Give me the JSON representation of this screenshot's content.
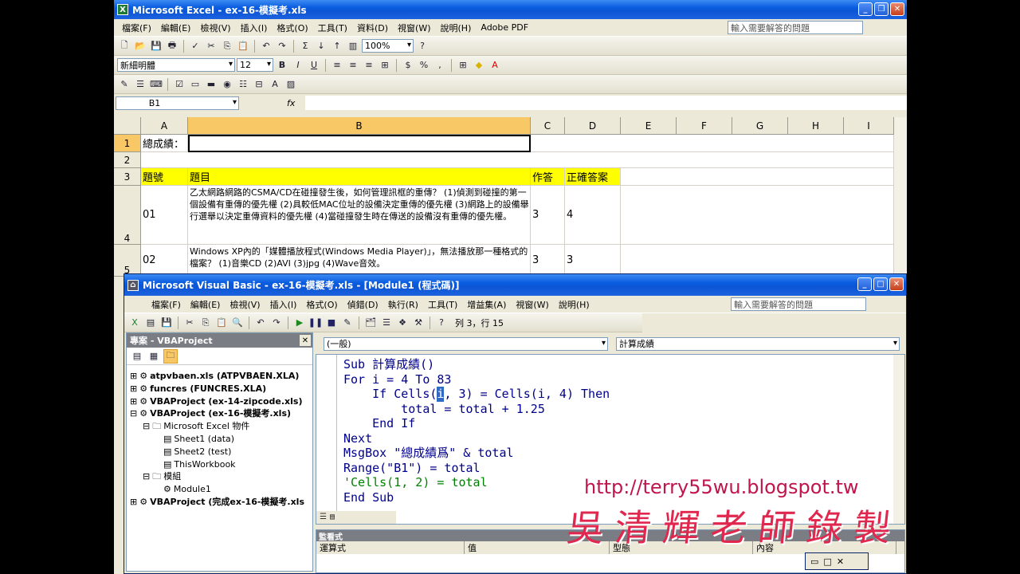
{
  "excel": {
    "title": "Microsoft Excel - ex-16-模擬考.xls",
    "menu": [
      "檔案(F)",
      "編輯(E)",
      "檢視(V)",
      "插入(I)",
      "格式(O)",
      "工具(T)",
      "資料(D)",
      "視窗(W)",
      "說明(H)",
      "Adobe PDF"
    ],
    "help_placeholder": "輸入需要解答的問題",
    "zoom": "100%",
    "font": "新細明體",
    "font_size": "12",
    "name_box": "B1",
    "fx": "fx",
    "columns": [
      "A",
      "B",
      "C",
      "D",
      "E",
      "F",
      "G",
      "H",
      "I"
    ],
    "rows": [
      "1",
      "2",
      "3",
      "4",
      "5"
    ],
    "cells": {
      "a1": "總成績：",
      "a3": "題號",
      "b3": "題目",
      "c3": "作答",
      "d3": "正確答案",
      "a4": "01",
      "b4": "乙太網路網路的CSMA/CD在碰撞發生後，如何管理訊框的重傳？ (1)偵測到碰撞的第一個設備有重傳的優先權 (2)具較低MAC位址的設備決定重傳的優先權 (3)網路上的設備舉行選舉以決定重傳資料的優先權 (4)當碰撞發生時在傳送的設備沒有重傳的優先權。",
      "c4": "3",
      "d4": "4",
      "a5": "02",
      "b5": "Windows XP內的「媒體播放程式(Windows Media Player)」，無法播放那一種格式的檔案？ (1)音樂CD (2)AVI (3)jpg (4)Wave音效。",
      "c5": "3",
      "d5": "3"
    }
  },
  "vbe": {
    "title": "Microsoft Visual Basic - ex-16-模擬考.xls - [Module1 (程式碼)]",
    "menu": [
      "檔案(F)",
      "編輯(E)",
      "檢視(V)",
      "插入(I)",
      "格式(O)",
      "偵錯(D)",
      "執行(R)",
      "工具(T)",
      "增益集(A)",
      "視窗(W)",
      "說明(H)"
    ],
    "help_placeholder": "輸入需要解答的問題",
    "position": "列 3，行 15",
    "project_title": "專案 - VBAProject",
    "tree": [
      "atpvbaen.xls (ATPVBAEN.XLA)",
      "funcres (FUNCRES.XLA)",
      "VBAProject (ex-14-zipcode.xls)",
      "VBAProject (ex-16-模擬考.xls)",
      "Microsoft Excel 物件",
      "Sheet1 (data)",
      "Sheet2 (test)",
      "ThisWorkbook",
      "模組",
      "Module1",
      "VBAProject (完成ex-16-模擬考.xls"
    ],
    "object_dropdown": "(一般)",
    "proc_dropdown": "計算成績",
    "code": {
      "l1": "Sub 計算成績()",
      "l2": "For i = 4 To 83",
      "l3a": "    If Cells(",
      "l3c": "i",
      "l3b": ", 3) = Cells(i, 4) Then",
      "l4": "        total = total + 1.25",
      "l5": "    End If",
      "l6": "Next",
      "l7": "MsgBox \"總成績爲\" & total",
      "l8": "Range(\"B1\") = total",
      "l9": "'Cells(1, 2) = total",
      "l10": "End Sub"
    },
    "watch_title": "監看式",
    "watch_cols": [
      "運算式",
      "值",
      "型態",
      "內容"
    ]
  },
  "watermark": {
    "url": "http://terry55wu.blogspot.tw",
    "name": "吳清輝老師錄製"
  }
}
